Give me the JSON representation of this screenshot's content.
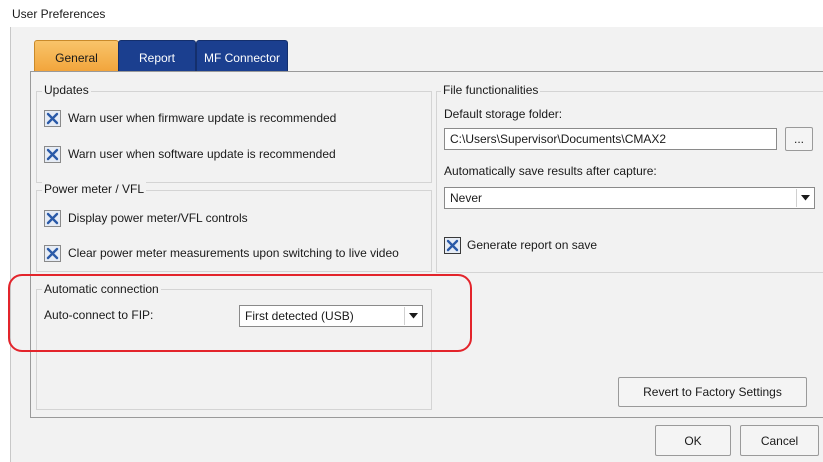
{
  "window": {
    "title": "User Preferences"
  },
  "tabs": [
    {
      "label": "General",
      "active": true
    },
    {
      "label": "Report",
      "active": false
    },
    {
      "label": "MF Connector",
      "active": false
    }
  ],
  "updates": {
    "title": "Updates",
    "items": [
      {
        "label": "Warn user when firmware update is recommended",
        "checked": true
      },
      {
        "label": "Warn user when software update is recommended",
        "checked": true
      }
    ]
  },
  "power_meter": {
    "title": "Power meter / VFL",
    "items": [
      {
        "label": "Display power meter/VFL controls",
        "checked": true
      },
      {
        "label": "Clear power meter measurements upon switching to live video",
        "checked": true
      }
    ]
  },
  "auto_connection": {
    "title": "Automatic connection",
    "label": "Auto-connect to FIP:",
    "value": "First detected (USB)"
  },
  "file_functionalities": {
    "title": "File functionalities",
    "storage_label": "Default storage folder:",
    "storage_value": "C:\\Users\\Supervisor\\Documents\\CMAX2",
    "browse_label": "...",
    "autosave_label": "Automatically save results after capture:",
    "autosave_value": "Never",
    "report_label": "Generate report on save",
    "report_checked": true
  },
  "buttons": {
    "revert": "Revert to Factory Settings",
    "ok": "OK",
    "cancel": "Cancel"
  },
  "colors": {
    "active_tab": "#f2a53c",
    "inactive_tab": "#1b3f8f",
    "highlight": "#e3242b"
  }
}
